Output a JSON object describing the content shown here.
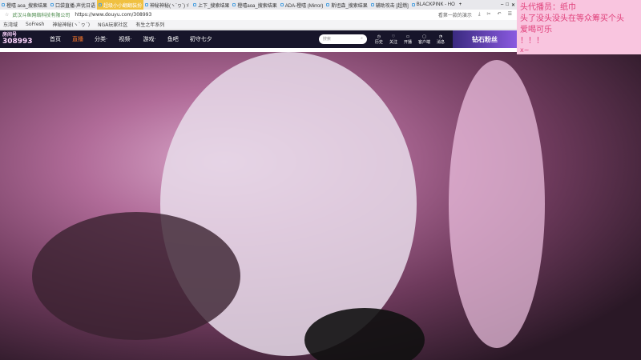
{
  "tabs": [
    {
      "label": "橙嘻 aoa_搜索结果"
    },
    {
      "label": "口袋直播-声优日语"
    },
    {
      "label": "超级小小翻翻装扮"
    },
    {
      "label": "神秘神秘(ヽ`ヮ´)ゞ"
    },
    {
      "label": "上下_搜索结果"
    },
    {
      "label": "橙嘻aoa_搜索结果"
    },
    {
      "label": "ADA-橙嘻 (Mirror)"
    },
    {
      "label": "斯坦森_搜索结果"
    },
    {
      "label": "辅助攻击 [超燃]"
    },
    {
      "label": "BLACKPINK - HO"
    }
  ],
  "address": {
    "site": "武汉斗鱼网络科技有限公司",
    "url": "https://www.douyu.com/308993",
    "search": "看第一款的演示"
  },
  "bookmarks": [
    "东湾域",
    "SoFresh",
    "神秘神秘(ヽ`ヮ´)",
    "NGA玩家社区",
    "有生之年系列"
  ],
  "nav": {
    "room_label": "房间号",
    "room": "308993",
    "items": [
      "首页",
      "直播",
      "分类·",
      "视频·",
      "游戏·",
      "鱼吧",
      "初守七夕"
    ],
    "search_placeholder": "搜索",
    "icons": [
      "历史",
      "关注",
      "开播",
      "客户端",
      "消息"
    ],
    "badge": "钻石粉丝"
  },
  "chat": [
    "头代播员：纸巾",
    "头了没头没头在等众筹买个头",
    "爱喝可乐",
    "！！！",
    "x~"
  ]
}
